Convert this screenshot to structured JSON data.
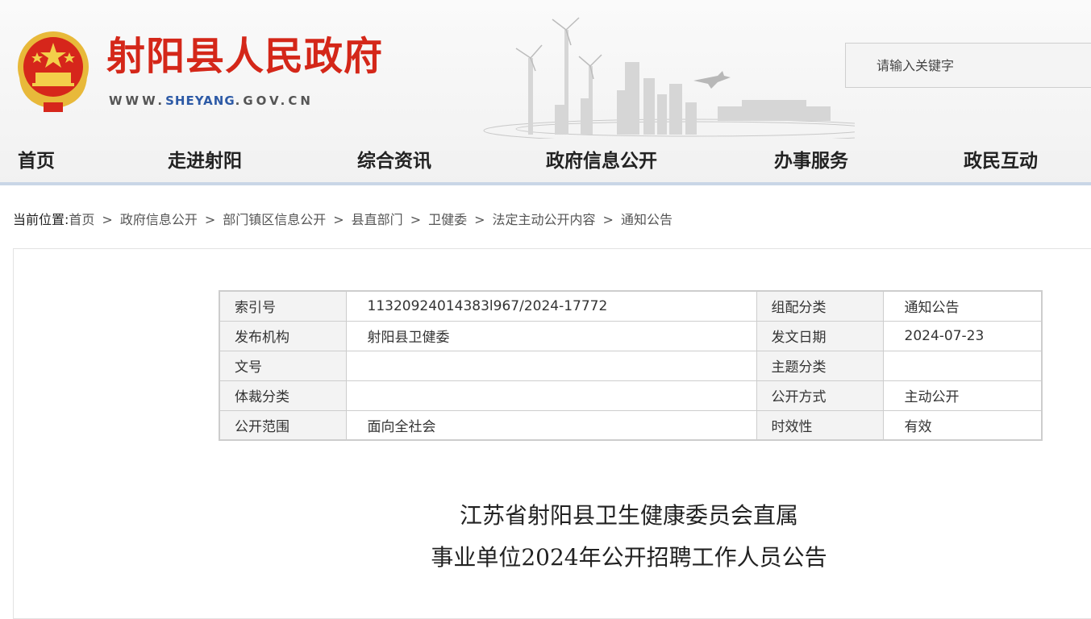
{
  "header": {
    "site_title": "射阳县人民政府",
    "url_prefix": "WWW.",
    "url_mid": "SHEYANG",
    "url_suffix": ".GOV.CN",
    "search_placeholder": "请输入关键字",
    "title_color": "#d42719",
    "url_accent_color": "#2d5aa6"
  },
  "nav": {
    "items": [
      "首页",
      "走进射阳",
      "综合资讯",
      "政府信息公开",
      "办事服务",
      "政民互动"
    ]
  },
  "breadcrumb": {
    "lead": "当前位置:",
    "items": [
      "首页",
      "政府信息公开",
      "部门镇区信息公开",
      "县直部门",
      "卫健委",
      "法定主动公开内容",
      "通知公告"
    ],
    "separator": ">"
  },
  "meta_table": {
    "rows": [
      {
        "k1": "索引号",
        "v1": "11320924014383l967/2024-17772",
        "k2": "组配分类",
        "v2": "通知公告"
      },
      {
        "k1": "发布机构",
        "v1": "射阳县卫健委",
        "k2": "发文日期",
        "v2": "2024-07-23"
      },
      {
        "k1": "文号",
        "v1": "",
        "k2": "主题分类",
        "v2": ""
      },
      {
        "k1": "体裁分类",
        "v1": "",
        "k2": "公开方式",
        "v2": "主动公开"
      },
      {
        "k1": "公开范围",
        "v1": "面向全社会",
        "k2": "时效性",
        "v2": "有效"
      }
    ]
  },
  "article": {
    "title_line1": "江苏省射阳县卫生健康委员会直属",
    "title_line2": "事业单位2024年公开招聘工作人员公告"
  }
}
